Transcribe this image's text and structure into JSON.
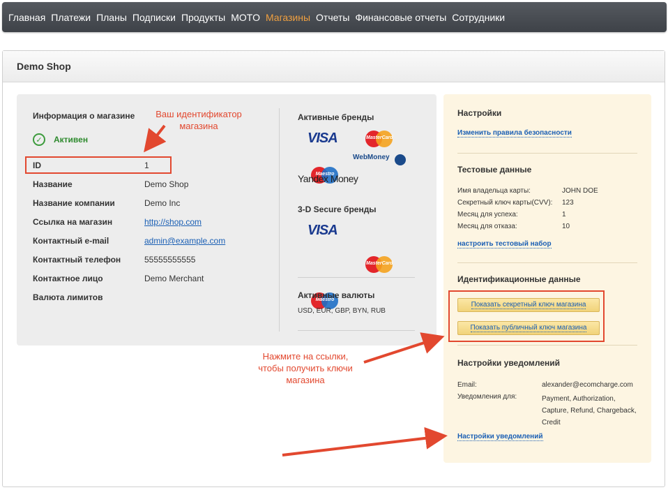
{
  "nav": {
    "items": [
      "Главная",
      "Платежи",
      "Планы",
      "Подписки",
      "Продукты",
      "MOTO",
      "Магазины",
      "Отчеты",
      "Финансовые отчеты",
      "Сотрудники"
    ],
    "active": "Магазины",
    "active_color": "#f0a040"
  },
  "panel": {
    "title": "Demo Shop"
  },
  "shop_info": {
    "title": "Информация о магазине",
    "status": "Активен",
    "rows": [
      {
        "key": "ID",
        "value": "1"
      },
      {
        "key": "Название",
        "value": "Demo Shop"
      },
      {
        "key": "Название компании",
        "value": "Demo Inc"
      },
      {
        "key": "Ссылка на магазин",
        "value": "http://shop.com"
      },
      {
        "key": "Контактный e-mail",
        "value": "admin@example.com"
      },
      {
        "key": "Контактный телефон",
        "value": "55555555555"
      },
      {
        "key": "Контактное лицо",
        "value": "Demo Merchant"
      },
      {
        "key": "Валюта лимитов",
        "value": ""
      }
    ]
  },
  "brands": {
    "active_title": "Активные бренды",
    "active": [
      "VISA",
      "MasterCard",
      "Maestro",
      "WebMoney",
      "Yandex Money"
    ],
    "secure_title": "3-D Secure бренды",
    "secure": [
      "VISA",
      "MasterCard",
      "Maestro"
    ],
    "currencies_title": "Активные валюты",
    "currencies": "USD, EUR, GBP, BYN, RUB"
  },
  "settings": {
    "title": "Настройки",
    "security_link": "Изменить правила безопасности"
  },
  "test_data": {
    "title": "Тестовые данные",
    "rows": [
      {
        "key": "Имя владельца карты:",
        "value": "JOHN DOE"
      },
      {
        "key": "Секретный ключ карты(CVV):",
        "value": "123"
      },
      {
        "key": "Месяц для успеха:",
        "value": "1"
      },
      {
        "key": "Месяц для отказа:",
        "value": "10"
      }
    ],
    "link": "настроить тестовый набор"
  },
  "identity": {
    "title": "Идентификационные данные",
    "secret_button": "Показать секретный ключ магазина",
    "public_button": "Показать публичный ключ магазина"
  },
  "notifications": {
    "title": "Настройки уведомлений",
    "email_label": "Email:",
    "email": "alexander@ecomcharge.com",
    "for_label": "Уведомления для:",
    "for_lines": [
      "Payment, Authorization,",
      "Capture, Refund, Chargeback,",
      "Credit"
    ],
    "link": "Настройки уведомлений"
  },
  "annotations": {
    "id_hint": [
      "Ваш идентификатор",
      "магазина"
    ],
    "keys_hint": [
      "Нажмите на ссылки,",
      "чтобы получить ключи",
      "магазина"
    ],
    "color": "#e2482f"
  }
}
